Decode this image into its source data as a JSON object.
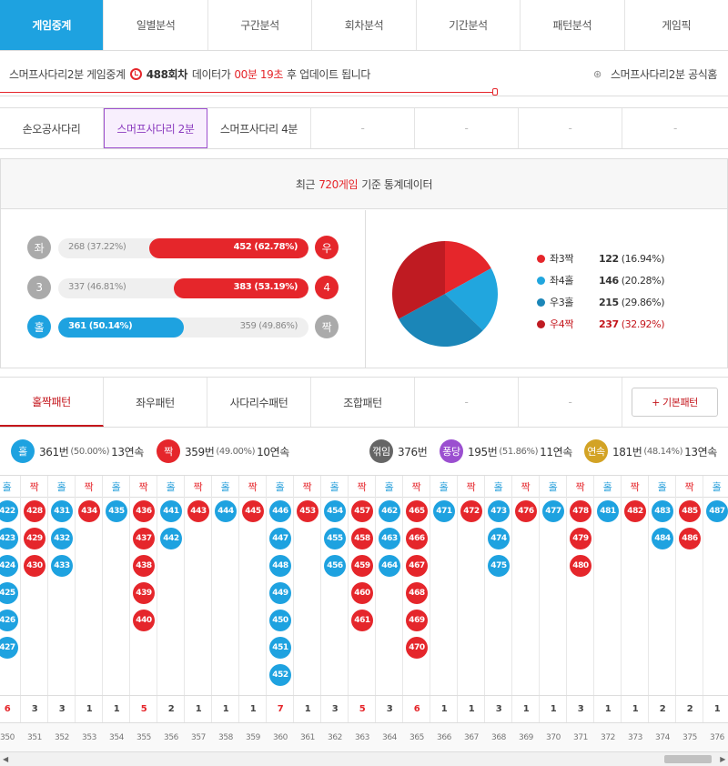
{
  "top_tabs": [
    "게임중계",
    "일별분석",
    "구간분석",
    "회차분석",
    "기간분석",
    "패턴분석",
    "게임픽"
  ],
  "info": {
    "prefix": "스머프사다리2분 게임중계",
    "round": "488회차",
    "mid": "데이터가",
    "timer": "00분 19초",
    "suffix": "후 업데이트 됩니다",
    "home_link": "스머프사다리2분 공식홈"
  },
  "game_tabs": [
    "손오공사다리",
    "스머프사다리 2분",
    "스머프사다리 4분",
    "-",
    "-",
    "-",
    "-"
  ],
  "stats": {
    "title_pre": "최근",
    "title_count": "720게임",
    "title_post": "기준 통계데이터",
    "bars": [
      {
        "left_label": "좌",
        "right_label": "우",
        "left_text": "268 (37.22%)",
        "right_text": "452 (62.78%)",
        "left_pct": 37.22,
        "right_pct": 62.78,
        "win": "right",
        "left_color": "#aaaaaa",
        "right_color": "#e5262b"
      },
      {
        "left_label": "3",
        "right_label": "4",
        "left_text": "337 (46.81%)",
        "right_text": "383 (53.19%)",
        "left_pct": 46.81,
        "right_pct": 53.19,
        "win": "right",
        "left_color": "#aaaaaa",
        "right_color": "#e5262b"
      },
      {
        "left_label": "홀",
        "right_label": "짝",
        "left_text": "361 (50.14%)",
        "right_text": "359 (49.86%)",
        "left_pct": 50.14,
        "right_pct": 49.86,
        "win": "left",
        "left_color": "#1ea2e0",
        "right_color": "#aaaaaa"
      }
    ],
    "pie": [
      {
        "name": "좌3짝",
        "value": 122,
        "pct": "(16.94%)",
        "color": "#e5262b"
      },
      {
        "name": "좌4홀",
        "value": 146,
        "pct": "(20.28%)",
        "color": "#21a6de"
      },
      {
        "name": "우3홀",
        "value": 215,
        "pct": "(29.86%)",
        "color": "#1b86b8"
      },
      {
        "name": "우4짝",
        "value": 237,
        "pct": "(32.92%)",
        "color": "#bf1b22"
      }
    ]
  },
  "pattern_tabs": [
    "홀짝패턴",
    "좌우패턴",
    "사다리수패턴",
    "조합패턴",
    "-",
    "-"
  ],
  "basic_pattern": "+ 기본패턴",
  "summary": [
    {
      "badge": "홀",
      "color": "#1ea2e0",
      "count": "361번",
      "pct": "(50.00%)",
      "streak": "13연속"
    },
    {
      "badge": "짝",
      "color": "#e5262b",
      "count": "359번",
      "pct": "(49.00%)",
      "streak": "10연속"
    },
    {
      "badge": "꺾임",
      "color": "#666666",
      "count": "376번",
      "pct": "",
      "streak": ""
    },
    {
      "badge": "퐁당",
      "color": "#9b4fd0",
      "count": "195번",
      "pct": "(51.86%)",
      "streak": "11연속"
    },
    {
      "badge": "연속",
      "color": "#d3a325",
      "count": "181번",
      "pct": "(48.14%)",
      "streak": "13연속"
    }
  ],
  "pattern_columns": [
    {
      "type": "홀",
      "balls": [
        "422",
        "423",
        "424",
        "425",
        "426",
        "427"
      ],
      "count": "6",
      "round": "350"
    },
    {
      "type": "짝",
      "balls": [
        "428",
        "429",
        "430"
      ],
      "count": "3",
      "round": "351"
    },
    {
      "type": "홀",
      "balls": [
        "431",
        "432",
        "433"
      ],
      "count": "3",
      "round": "352"
    },
    {
      "type": "짝",
      "balls": [
        "434"
      ],
      "count": "1",
      "round": "353"
    },
    {
      "type": "홀",
      "balls": [
        "435"
      ],
      "count": "1",
      "round": "354"
    },
    {
      "type": "짝",
      "balls": [
        "436",
        "437",
        "438",
        "439",
        "440"
      ],
      "count": "5",
      "round": "355"
    },
    {
      "type": "홀",
      "balls": [
        "441",
        "442"
      ],
      "count": "2",
      "round": "356"
    },
    {
      "type": "짝",
      "balls": [
        "443"
      ],
      "count": "1",
      "round": "357"
    },
    {
      "type": "홀",
      "balls": [
        "444"
      ],
      "count": "1",
      "round": "358"
    },
    {
      "type": "짝",
      "balls": [
        "445"
      ],
      "count": "1",
      "round": "359"
    },
    {
      "type": "홀",
      "balls": [
        "446",
        "447",
        "448",
        "449",
        "450",
        "451",
        "452"
      ],
      "count": "7",
      "round": "360"
    },
    {
      "type": "짝",
      "balls": [
        "453"
      ],
      "count": "1",
      "round": "361"
    },
    {
      "type": "홀",
      "balls": [
        "454",
        "455",
        "456"
      ],
      "count": "3",
      "round": "362"
    },
    {
      "type": "짝",
      "balls": [
        "457",
        "458",
        "459",
        "460",
        "461"
      ],
      "count": "5",
      "round": "363"
    },
    {
      "type": "홀",
      "balls": [
        "462",
        "463",
        "464"
      ],
      "count": "3",
      "round": "364"
    },
    {
      "type": "짝",
      "balls": [
        "465",
        "466",
        "467",
        "468",
        "469",
        "470"
      ],
      "count": "6",
      "round": "365"
    },
    {
      "type": "홀",
      "balls": [
        "471"
      ],
      "count": "1",
      "round": "366"
    },
    {
      "type": "짝",
      "balls": [
        "472"
      ],
      "count": "1",
      "round": "367"
    },
    {
      "type": "홀",
      "balls": [
        "473",
        "474",
        "475"
      ],
      "count": "3",
      "round": "368"
    },
    {
      "type": "짝",
      "balls": [
        "476"
      ],
      "count": "1",
      "round": "369"
    },
    {
      "type": "홀",
      "balls": [
        "477"
      ],
      "count": "1",
      "round": "370"
    },
    {
      "type": "짝",
      "balls": [
        "478",
        "479",
        "480"
      ],
      "count": "3",
      "round": "371"
    },
    {
      "type": "홀",
      "balls": [
        "481"
      ],
      "count": "1",
      "round": "372"
    },
    {
      "type": "짝",
      "balls": [
        "482"
      ],
      "count": "1",
      "round": "373"
    },
    {
      "type": "홀",
      "balls": [
        "483",
        "484"
      ],
      "count": "2",
      "round": "374"
    },
    {
      "type": "짝",
      "balls": [
        "485",
        "486"
      ],
      "count": "2",
      "round": "375"
    },
    {
      "type": "홀",
      "balls": [
        "487"
      ],
      "count": "1",
      "round": "376"
    }
  ]
}
